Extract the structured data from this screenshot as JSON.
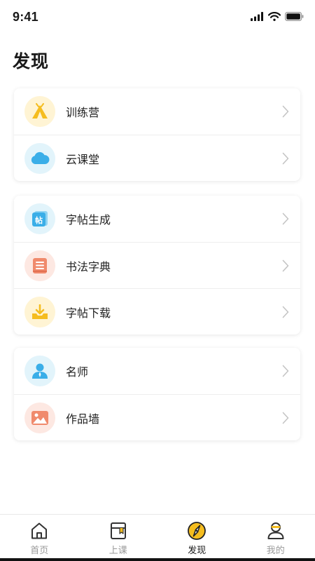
{
  "status_bar": {
    "time": "9:41"
  },
  "page_title": "发现",
  "groups": [
    {
      "items": [
        {
          "label": "训练营",
          "icon": "tent-icon",
          "bg": "#fff4d4",
          "color": "#f5bd1f"
        },
        {
          "label": "云课堂",
          "icon": "cloud-icon",
          "bg": "#e2f4fb",
          "color": "#3aaee8"
        }
      ]
    },
    {
      "items": [
        {
          "label": "字帖生成",
          "icon": "copybook-icon",
          "bg": "#e2f4fb",
          "color": "#3aaee8",
          "glyph": "帖"
        },
        {
          "label": "书法字典",
          "icon": "dictionary-book-icon",
          "bg": "#fde8e2",
          "color": "#f08a6c"
        },
        {
          "label": "字帖下载",
          "icon": "download-tray-icon",
          "bg": "#fff4d4",
          "color": "#f5bd1f"
        }
      ]
    },
    {
      "items": [
        {
          "label": "名师",
          "icon": "teacher-person-icon",
          "bg": "#e2f4fb",
          "color": "#3aaee8"
        },
        {
          "label": "作品墙",
          "icon": "picture-gallery-icon",
          "bg": "#fde8e2",
          "color": "#f08a6c"
        }
      ]
    }
  ],
  "tabbar": [
    {
      "label": "首页",
      "icon": "home-icon",
      "active": false
    },
    {
      "label": "上课",
      "icon": "book-icon",
      "active": false
    },
    {
      "label": "发现",
      "icon": "compass-icon",
      "active": true
    },
    {
      "label": "我的",
      "icon": "profile-icon",
      "active": false
    }
  ],
  "colors": {
    "accent": "#f5bd1f",
    "inactive_tab": "#9a9a9a"
  }
}
